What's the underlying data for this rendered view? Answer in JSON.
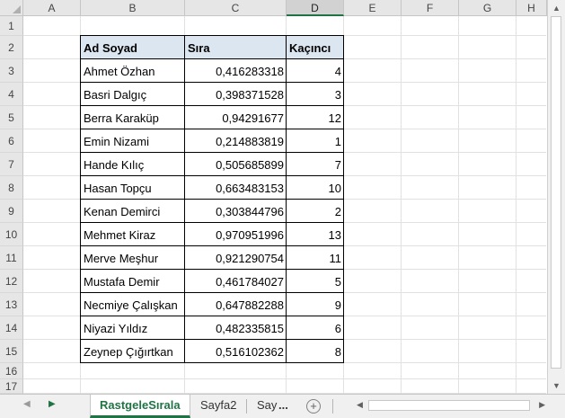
{
  "columns": [
    "A",
    "B",
    "C",
    "D",
    "E",
    "F",
    "G",
    "H"
  ],
  "selected_column": "D",
  "rows": [
    "1",
    "2",
    "3",
    "4",
    "5",
    "6",
    "7",
    "8",
    "9",
    "10",
    "11",
    "12",
    "13",
    "14",
    "15",
    "16",
    "17"
  ],
  "table": {
    "headers": [
      "Ad Soyad",
      "Sıra",
      "Kaçıncı"
    ],
    "rows": [
      [
        "Ahmet Özhan",
        "0,416283318",
        "4"
      ],
      [
        "Basri Dalgıç",
        "0,398371528",
        "3"
      ],
      [
        "Berra Karaküp",
        "0,94291677",
        "12"
      ],
      [
        "Emin Nizami",
        "0,214883819",
        "1"
      ],
      [
        "Hande Kılıç",
        "0,505685899",
        "7"
      ],
      [
        "Hasan Topçu",
        "0,663483153",
        "10"
      ],
      [
        "Kenan Demirci",
        "0,303844796",
        "2"
      ],
      [
        "Mehmet Kiraz",
        "0,970951996",
        "13"
      ],
      [
        "Merve Meşhur",
        "0,921290754",
        "11"
      ],
      [
        "Mustafa Demir",
        "0,461784027",
        "5"
      ],
      [
        "Necmiye Çalışkan",
        "0,647882288",
        "9"
      ],
      [
        "Niyazi Yıldız",
        "0,482335815",
        "6"
      ],
      [
        "Zeynep Çığırtkan",
        "0,516102362",
        "8"
      ]
    ]
  },
  "sheet_tabs": {
    "active": "RastgeleSırala",
    "second": "Sayfa2",
    "third": "Say",
    "more": "..."
  },
  "icons": {
    "nav_prev": "triangle-left",
    "nav_next": "triangle-right",
    "add_sheet": "plus-circle",
    "scroll_up": "triangle-up",
    "scroll_down": "triangle-down",
    "scroll_left": "triangle-left",
    "scroll_right": "triangle-right"
  },
  "colors": {
    "accent": "#217346",
    "header_fill": "#dce6f1"
  }
}
